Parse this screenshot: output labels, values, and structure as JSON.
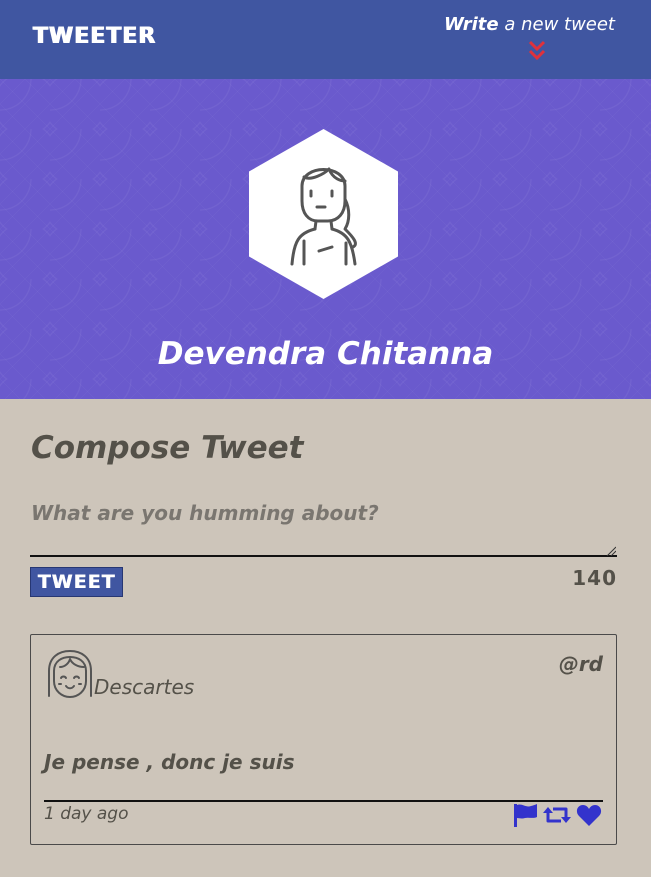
{
  "nav": {
    "brand": "TWEETER",
    "compose_toggle": {
      "strong": "Write",
      "rest": " a new tweet",
      "icon": "double-chevron-down-icon",
      "icon_color": "#e0313b"
    },
    "background": "#4056a1"
  },
  "profile": {
    "name": "Devendra Chitanna",
    "avatar_icon": "user-avatar-icon",
    "header_background": "#6a5acd"
  },
  "compose": {
    "title": "Compose Tweet",
    "placeholder": "What are you humming about?",
    "value": "",
    "submit_label": "TWEET",
    "counter": "140"
  },
  "tweets": [
    {
      "avatar_icon": "user-avatar-icon",
      "author": "Descartes",
      "handle": "@rd",
      "content": "Je pense , donc je suis",
      "time": "1 day ago",
      "actions": [
        "flag-icon",
        "retweet-icon",
        "heart-icon"
      ],
      "action_color": "#3333cc"
    }
  ]
}
